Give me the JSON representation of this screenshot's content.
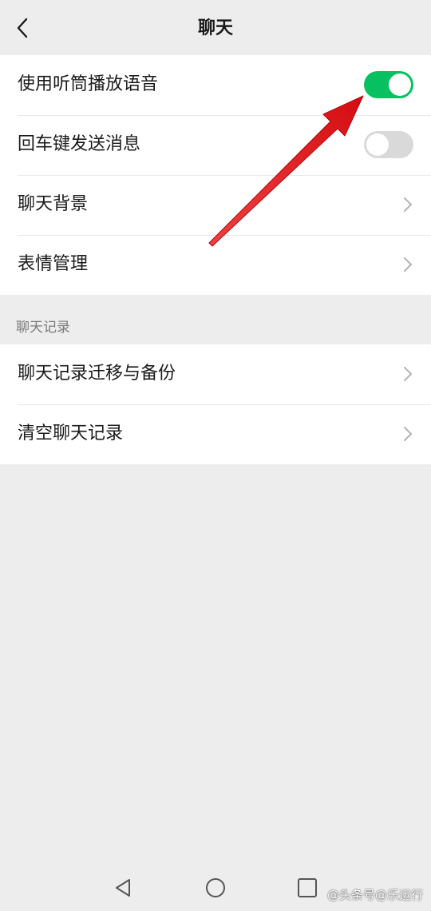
{
  "header": {
    "title": "聊天"
  },
  "settings": {
    "rows": [
      {
        "label": "使用听筒播放语音",
        "type": "toggle",
        "state": "on"
      },
      {
        "label": "回车键发送消息",
        "type": "toggle",
        "state": "off"
      },
      {
        "label": "聊天背景",
        "type": "link"
      },
      {
        "label": "表情管理",
        "type": "link"
      }
    ]
  },
  "chat_history": {
    "section_label": "聊天记录",
    "rows": [
      {
        "label": "聊天记录迁移与备份",
        "type": "link"
      },
      {
        "label": "清空聊天记录",
        "type": "link"
      }
    ]
  },
  "watermark": "@头条号@乐运行",
  "colors": {
    "toggle_on": "#07c160",
    "toggle_off": "#d9d9d9",
    "background": "#ededed",
    "annotation_arrow": "#e8141a"
  },
  "icons": {
    "back": "chevron-left-icon",
    "row_link": "chevron-right-icon",
    "nav_back": "triangle-back-icon",
    "nav_home": "circle-home-icon",
    "nav_recent": "square-recent-icon"
  }
}
